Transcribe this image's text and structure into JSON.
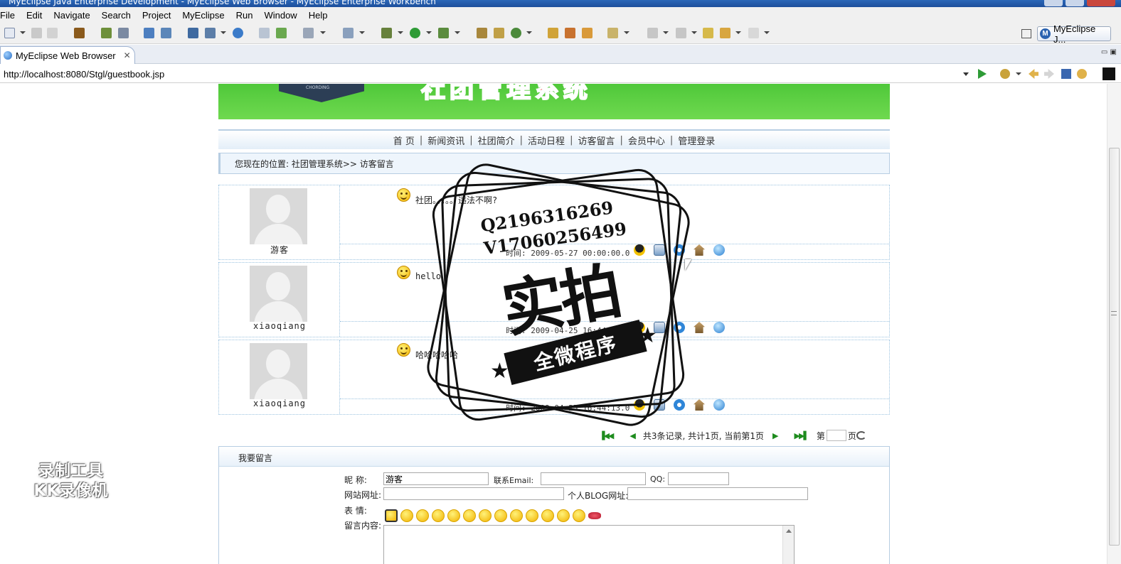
{
  "window": {
    "title": "MyEclipse Java Enterprise Development - MyEclipse Web Browser - MyEclipse Enterprise Workbench"
  },
  "menu": [
    "File",
    "Edit",
    "Navigate",
    "Search",
    "Project",
    "MyEclipse",
    "Run",
    "Window",
    "Help"
  ],
  "perspective": {
    "label": "MyEclipse J..."
  },
  "editor_tab": {
    "label": "MyEclipse Web Browser"
  },
  "browser": {
    "url": "http://localhost:8080/Stgl/guestbook.jsp"
  },
  "site": {
    "banner_text": "社团管理系统",
    "banner_tag": "CHORDING",
    "nav": [
      "首 页",
      "新闻资讯",
      "社团简介",
      "活动日程",
      "访客留言",
      "会员中心",
      "管理登录"
    ],
    "breadcrumb": "您现在的位置: 社团管理系统>> 访客留言"
  },
  "messages": [
    {
      "user": "游客",
      "content": "社团。。。。。违法不啊?",
      "time": "时间: 2009-05-27 00:00:00.0"
    },
    {
      "user": "xiaoqiang",
      "content": "hello",
      "time": "时间: 2009-04-25 16:44:00.0"
    },
    {
      "user": "xiaoqiang",
      "content": "哈哈哈哈哈",
      "time": "时间: 2009-04-25 16:44:13.0"
    }
  ],
  "pager": {
    "summary": "共3条记录, 共计1页, 当前第1页",
    "page_prefix": "第",
    "page_suffix": "页"
  },
  "form": {
    "heading": "我要留言",
    "nickname_label": "昵    称:",
    "nickname_value": "游客",
    "email_label": "联系Email:",
    "qq_label": "QQ:",
    "website_label": "网站网址:",
    "blog_label": "个人BLOG网址:",
    "mood_label": "表    情:",
    "content_label": "留言内容:"
  },
  "watermark": {
    "contact_q": "Q2196316269",
    "contact_v": "V17060256499",
    "big": "实拍",
    "ribbon": "全微程序"
  },
  "recorder": {
    "line1": "录制工具",
    "line2": "KK录像机"
  }
}
